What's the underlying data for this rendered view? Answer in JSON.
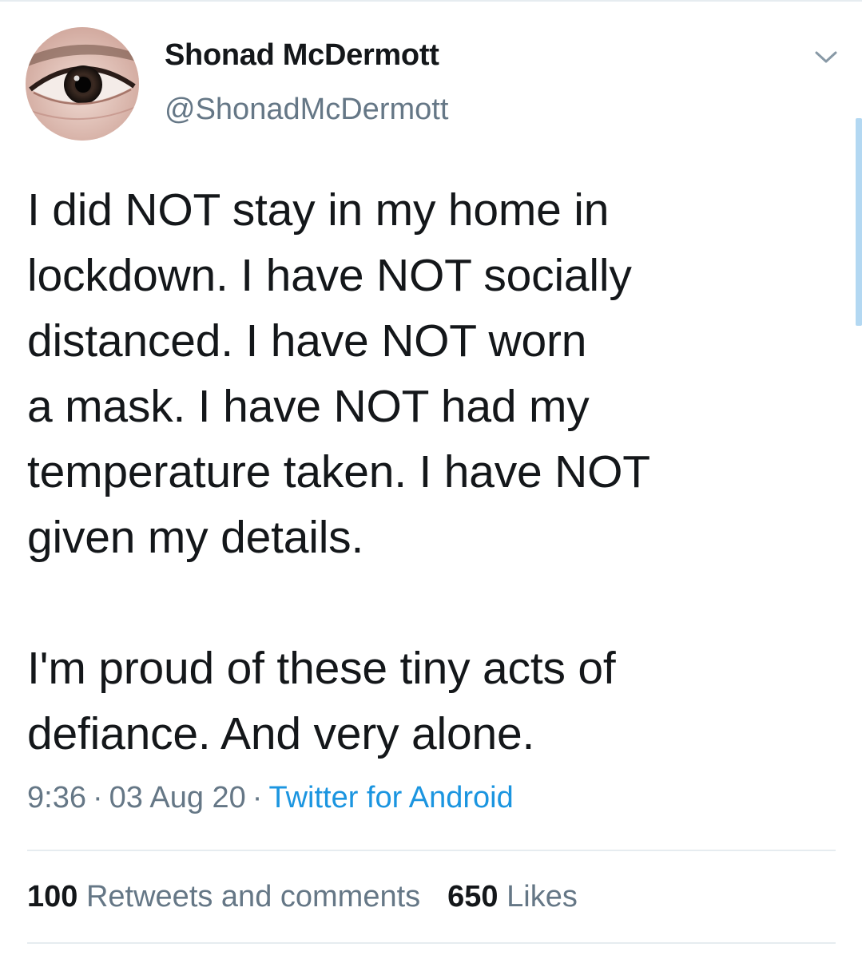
{
  "tweet": {
    "author": {
      "display_name": "Shonad McDermott",
      "handle": "@ShonadMcDermott"
    },
    "text": "I did NOT stay in my home in\nlockdown. I have NOT socially\ndistanced. I have NOT worn\na mask. I have NOT had my\ntemperature taken. I have NOT\ngiven my details.\n\nI'm proud of these tiny acts of\ndefiance. And very alone.",
    "time": "9:36",
    "date": "03 Aug 20",
    "separator": "·",
    "source": "Twitter for Android",
    "retweets_count": "100",
    "retweets_label": "Retweets and comments",
    "likes_count": "650",
    "likes_label": "Likes"
  },
  "icons": {
    "menu": "chevron-down-icon",
    "avatar": "eye-photo"
  },
  "colors": {
    "text": "#14171a",
    "secondary": "#657786",
    "link": "#1b95e0",
    "divider": "#e6ecf0"
  }
}
